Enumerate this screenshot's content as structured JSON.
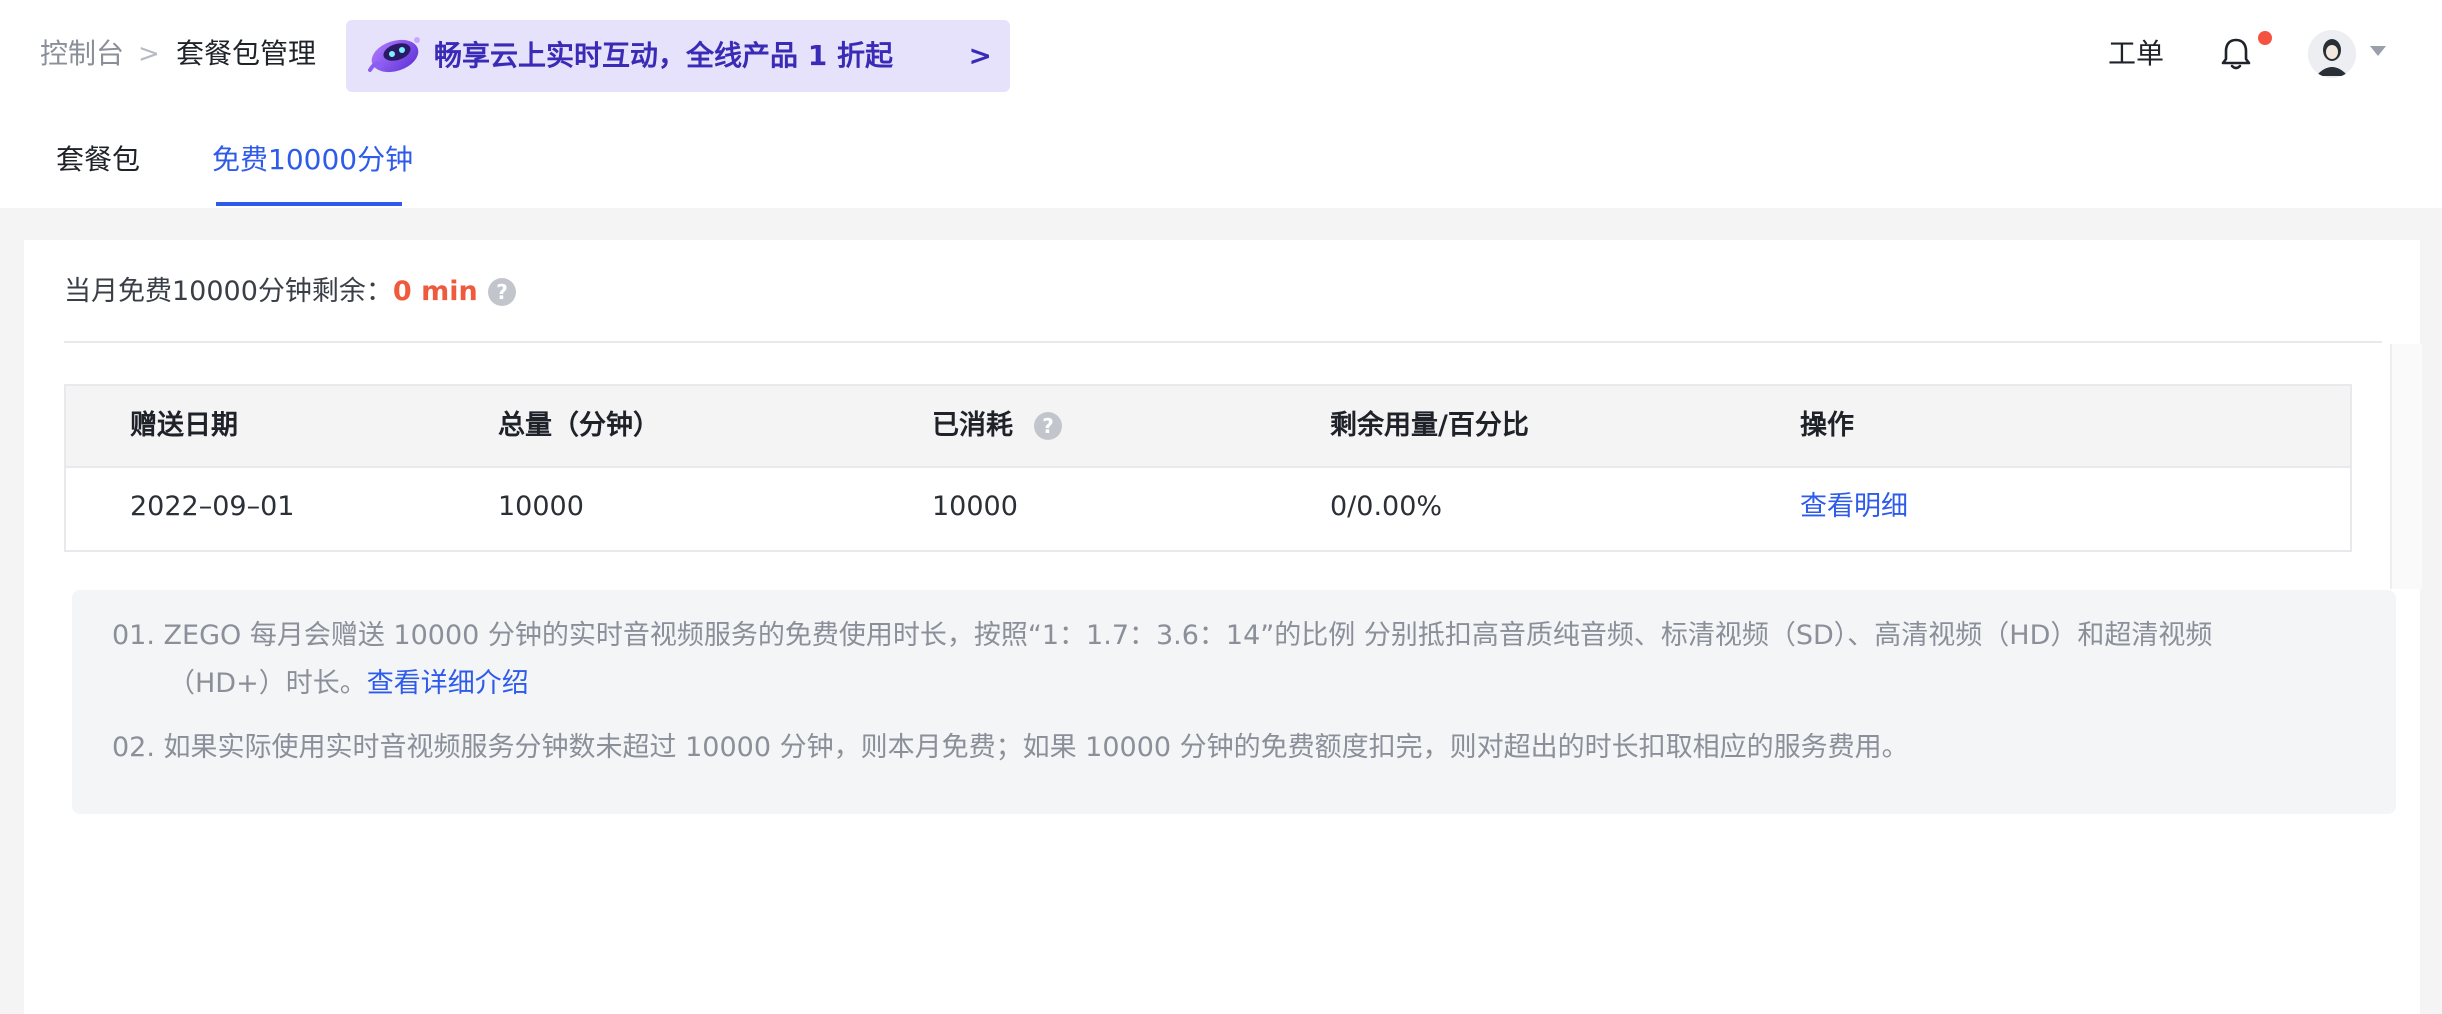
{
  "breadcrumb": {
    "root": "控制台",
    "separator": ">",
    "current": "套餐包管理"
  },
  "promo": {
    "text": "畅享云上实时互动，全线产品 1 折起",
    "arrow": ">",
    "icon": "robot-mascot-icon"
  },
  "header": {
    "ticket_label": "工单",
    "bell_icon": "bell-icon",
    "avatar_icon": "avatar-icon",
    "notification_dot_color": "#f4533f"
  },
  "tabs": [
    {
      "label": "套餐包",
      "active": false
    },
    {
      "label": "免费10000分钟",
      "active": true
    }
  ],
  "summary": {
    "label": "当月免费10000分钟剩余：",
    "value": "0 min",
    "help_icon": "?"
  },
  "table": {
    "headers": [
      "赠送日期",
      "总量（分钟）",
      "已消耗",
      "剩余用量/百分比",
      "操作"
    ],
    "rows": [
      {
        "date": "2022–09–01",
        "total": "10000",
        "consumed": "10000",
        "remaining": "0/0.00%",
        "action": "查看明细"
      }
    ]
  },
  "notes": {
    "note1_line1": "01. ZEGO 每月会赠送 10000 分钟的实时音视频服务的免费使用时长，按照“1：1.7：3.6：14”的比例 分别抵扣高音质纯音频、标清视频（SD）、高清视频（HD）和超清视频",
    "note1_line2": "（HD+）时长。",
    "note1_link": "查看详细介绍",
    "note2": "02. 如果实际使用实时音视频服务分钟数未超过 10000 分钟，则本月免费；如果 10000 分钟的免费额度扣完，则对超出的时长扣取相应的服务费用。"
  },
  "colors": {
    "accent": "#2e5bea",
    "warning": "#f05a3c",
    "promo_bg": "#e6e2fb",
    "promo_text": "#3a2bb6"
  }
}
